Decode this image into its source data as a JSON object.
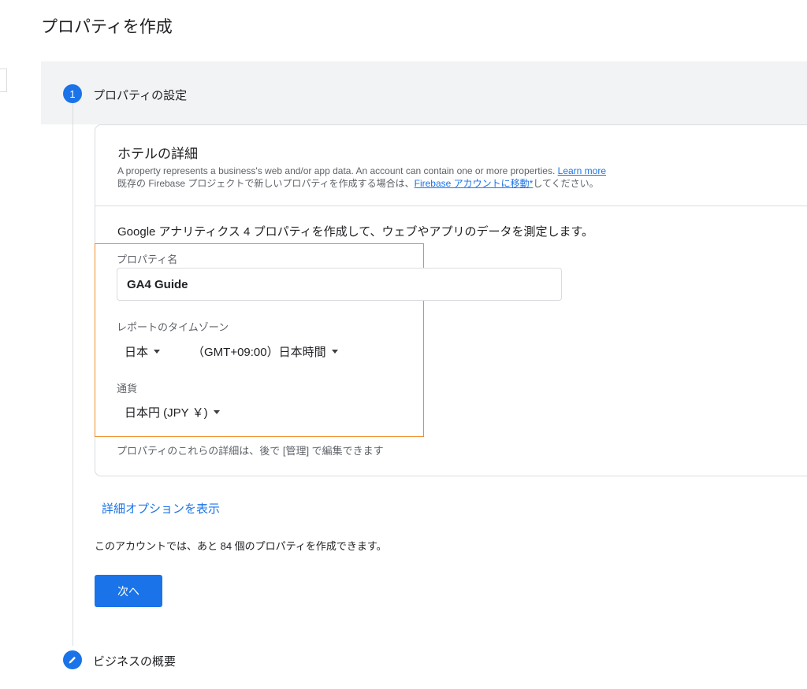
{
  "page": {
    "title": "プロパティを作成"
  },
  "steps": [
    {
      "number": "1",
      "label": "プロパティの設定"
    },
    {
      "icon": "pencil-icon",
      "label": "ビジネスの概要"
    }
  ],
  "card": {
    "title": "ホテルの詳細",
    "desc_line1": "A property represents a business's web and/or app data. An account can contain one or more properties. ",
    "learn_more": "Learn more",
    "desc_line2_prefix": "既存の Firebase プロジェクトで新しいプロパティを作成する場合は、",
    "firebase_link": "Firebase アカウントに移動*",
    "desc_line2_suffix": "してください。",
    "intro": "Google アナリティクス 4 プロパティを作成して、ウェブやアプリのデータを測定します。"
  },
  "form": {
    "property_name_label": "プロパティ名",
    "property_name_value": "GA4 Guide",
    "timezone_label": "レポートのタイムゾーン",
    "country": "日本",
    "timezone": "（GMT+09:00）日本時間",
    "currency_label": "通貨",
    "currency": "日本円 (JPY ￥)",
    "note": "プロパティのこれらの詳細は、後で [管理] で編集できます"
  },
  "advanced_options": "詳細オプションを表示",
  "remaining_text": "このアカウントでは、あと 84 個のプロパティを作成できます。",
  "next_button": "次へ",
  "colors": {
    "accent": "#1a73e8",
    "highlight": "#f08c2a",
    "header_bg": "#f1f3f4"
  }
}
